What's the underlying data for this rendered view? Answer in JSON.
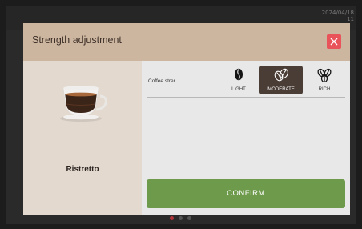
{
  "status_bar": {
    "date": "2024/04/18",
    "time": "11"
  },
  "dialog": {
    "title": "Strength adjustment",
    "close_icon": "close-icon"
  },
  "product": {
    "name": "Ristretto",
    "icon": "espresso-cup-icon"
  },
  "strength": {
    "label": "Coffee strer",
    "options": [
      {
        "label": "LIGHT",
        "icon": "single-bean-icon",
        "selected": false
      },
      {
        "label": "MODERATE",
        "icon": "two-beans-icon",
        "selected": true
      },
      {
        "label": "RICH",
        "icon": "three-beans-icon",
        "selected": false
      }
    ]
  },
  "confirm_label": "CONFIRM",
  "pagination": {
    "current": 1,
    "total": 3
  },
  "colors": {
    "header": "#cdb6a0",
    "close": "#e8545a",
    "selected_option": "#4a3d36",
    "confirm": "#6e9a4c",
    "left_panel": "#e3d9ce"
  }
}
